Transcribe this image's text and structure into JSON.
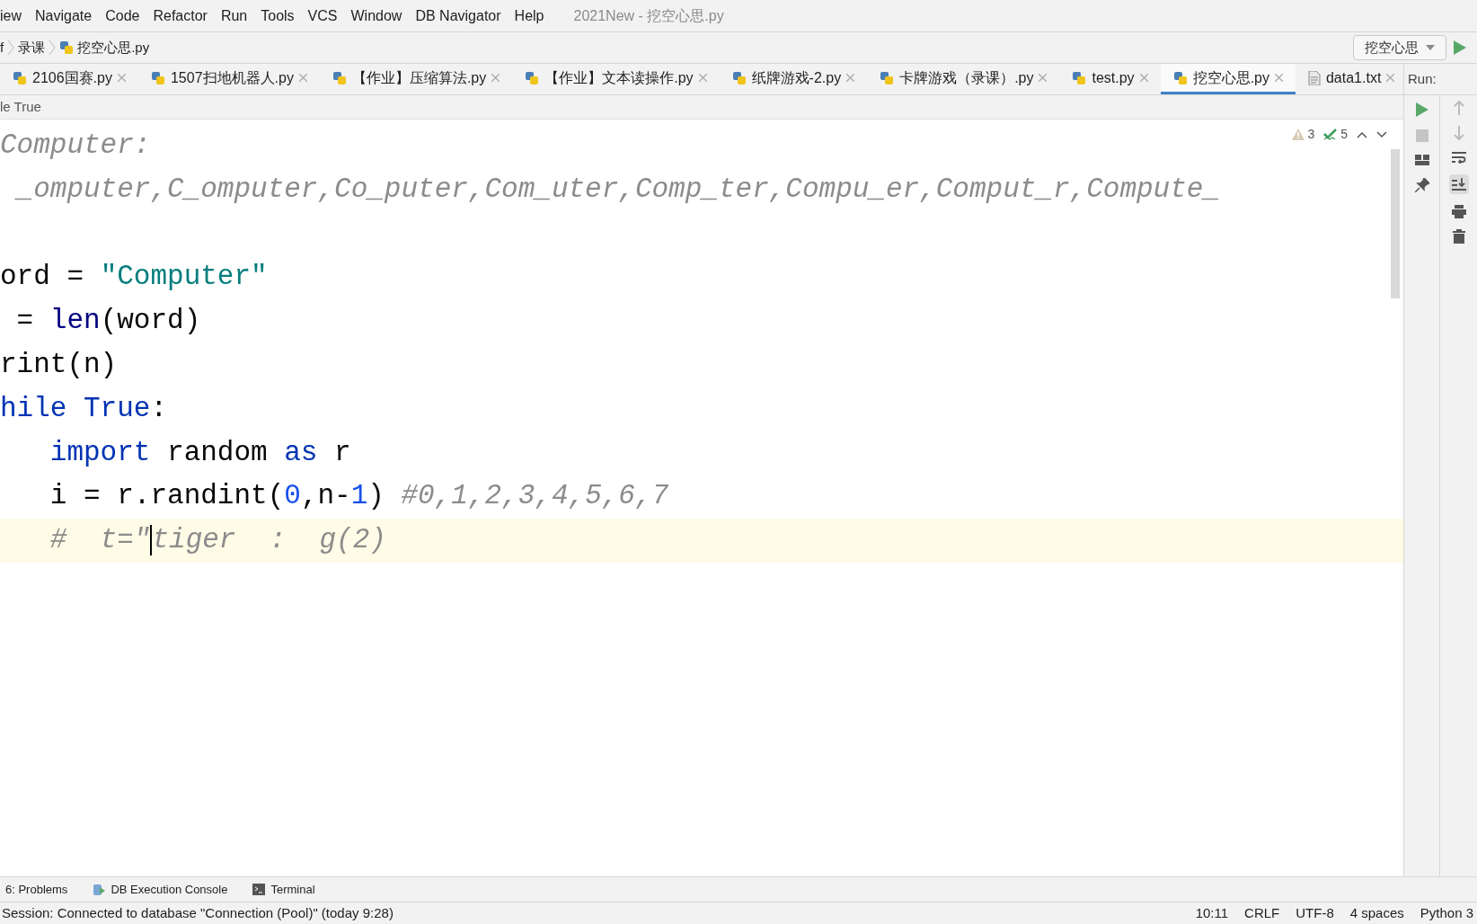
{
  "menu": [
    "iew",
    "Navigate",
    "Code",
    "Refactor",
    "Run",
    "Tools",
    "VCS",
    "Window",
    "DB Navigator",
    "Help"
  ],
  "window": {
    "title": "2021New - 挖空心思.py"
  },
  "breadcrumbs": [
    "f",
    "录课",
    "挖空心思.py"
  ],
  "run_config": {
    "label": "挖空心思"
  },
  "tabs": [
    {
      "label": "2106国赛.py",
      "kind": "py",
      "selected": false
    },
    {
      "label": "1507扫地机器人.py",
      "kind": "py",
      "selected": false
    },
    {
      "label": "【作业】压缩算法.py",
      "kind": "py",
      "selected": false
    },
    {
      "label": "【作业】文本读操作.py",
      "kind": "py",
      "selected": false
    },
    {
      "label": "纸牌游戏-2.py",
      "kind": "py",
      "selected": false
    },
    {
      "label": "卡牌游戏（录课）.py",
      "kind": "py",
      "selected": false
    },
    {
      "label": "test.py",
      "kind": "py",
      "selected": false
    },
    {
      "label": "挖空心思.py",
      "kind": "py",
      "selected": true
    },
    {
      "label": "data1.txt",
      "kind": "txt",
      "selected": false
    }
  ],
  "run_panel": {
    "title": "Run:"
  },
  "editor_breadcrumb": "le True",
  "inspections": {
    "warnings": "3",
    "weak_warnings": "5"
  },
  "lines": [
    {
      "current": false,
      "tokens": [
        {
          "kind": "comment",
          "text": "Computer:"
        }
      ]
    },
    {
      "current": false,
      "tokens": [
        {
          "kind": "comment",
          "text": " _omputer,C_omputer,Co_puter,Com_uter,Comp_ter,Compu_er,Comput_r,Compute_"
        }
      ]
    },
    {
      "current": false
    },
    {
      "current": false,
      "tokens": [
        {
          "kind": "plain",
          "text": "ord = "
        },
        {
          "kind": "string",
          "text": "\"Computer\""
        }
      ]
    },
    {
      "current": false,
      "tokens": [
        {
          "kind": "plain",
          "text": " = "
        },
        {
          "kind": "builtin",
          "text": "len"
        },
        {
          "kind": "plain",
          "text": "(word)"
        }
      ]
    },
    {
      "current": false,
      "tokens": [
        {
          "kind": "plain",
          "text": "rint(n)"
        }
      ]
    },
    {
      "current": false,
      "tokens": [
        {
          "kind": "keyword",
          "text": "hile True"
        },
        {
          "kind": "plain",
          "text": ":"
        }
      ]
    },
    {
      "current": false,
      "tokens": [
        {
          "kind": "keyword",
          "text": "   import"
        },
        {
          "kind": "plain",
          "text": " random "
        },
        {
          "kind": "keyword",
          "text": "as"
        },
        {
          "kind": "plain",
          "text": " r"
        }
      ]
    },
    {
      "current": false,
      "tokens": [
        {
          "kind": "plain",
          "text": "   i = r.randint("
        },
        {
          "kind": "number",
          "text": "0"
        },
        {
          "kind": "plain",
          "text": ",n-"
        },
        {
          "kind": "number",
          "text": "1"
        },
        {
          "kind": "plain",
          "text": ") "
        },
        {
          "kind": "comment",
          "text": "#0,1,2,3,4,5,6,7"
        }
      ]
    },
    {
      "current": true,
      "tokens": [
        {
          "kind": "comment",
          "text": "   #  t=\""
        },
        {
          "kind": "caret"
        },
        {
          "kind": "comment",
          "text": "tiger  :  g(2)"
        }
      ]
    }
  ],
  "tool_windows": [
    {
      "label": "6: Problems",
      "kind": "problems"
    },
    {
      "label": "DB Execution Console",
      "kind": "db"
    },
    {
      "label": "Terminal",
      "kind": "terminal"
    }
  ],
  "status_bar": {
    "message": "Session: Connected to database \"Connection (Pool)\" (today 9:28)",
    "items": [
      "10:11",
      "CRLF",
      "UTF-8",
      "4 spaces",
      "Python 3"
    ]
  }
}
